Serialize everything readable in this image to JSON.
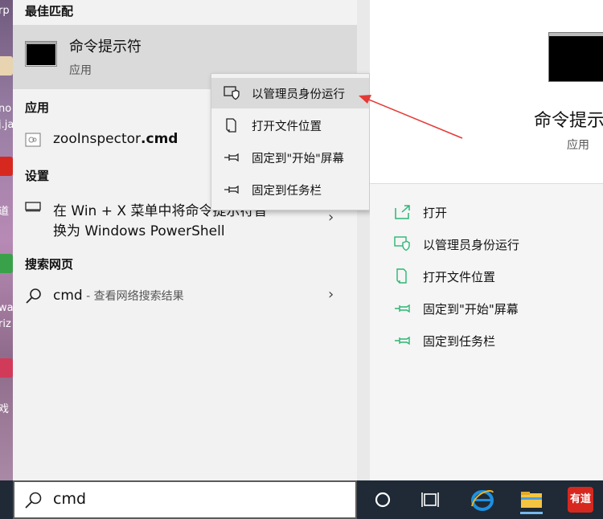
{
  "desktop": {
    "fragments": [
      "rp",
      "no",
      "j.ja",
      "道",
      "wa",
      "riz",
      "戏"
    ]
  },
  "sections": {
    "best_match": "最佳匹配",
    "apps": "应用",
    "settings": "设置",
    "web": "搜索网页"
  },
  "best": {
    "title": "命令提示符",
    "subtitle": "应用"
  },
  "apps": {
    "item_name": "zooInspector",
    "item_ext": ".cmd"
  },
  "settings": {
    "line1": "在 Win + X 菜单中将命令提示符替",
    "line2": "换为 Windows PowerShell"
  },
  "web": {
    "query": "cmd",
    "hint": " - 查看网络搜索结果"
  },
  "context_menu": [
    {
      "label": "以管理员身份运行",
      "icon": "shield-window-icon"
    },
    {
      "label": "打开文件位置",
      "icon": "file-location-icon"
    },
    {
      "label": "固定到\"开始\"屏幕",
      "icon": "pin-icon"
    },
    {
      "label": "固定到任务栏",
      "icon": "pin-icon"
    }
  ],
  "right_panel": {
    "title": "命令提示符",
    "subtitle": "应用",
    "actions": [
      {
        "label": "打开",
        "icon": "open-icon"
      },
      {
        "label": "以管理员身份运行",
        "icon": "shield-window-icon"
      },
      {
        "label": "打开文件位置",
        "icon": "file-location-icon"
      },
      {
        "label": "固定到\"开始\"屏幕",
        "icon": "pin-icon"
      },
      {
        "label": "固定到任务栏",
        "icon": "pin-icon"
      }
    ]
  },
  "search": {
    "value": "cmd"
  },
  "taskbar": {
    "youdao_label": "有道"
  },
  "colors": {
    "accent_green": "#2bb673",
    "annotation_red": "#e53935",
    "taskbar": "#1f2a36"
  }
}
